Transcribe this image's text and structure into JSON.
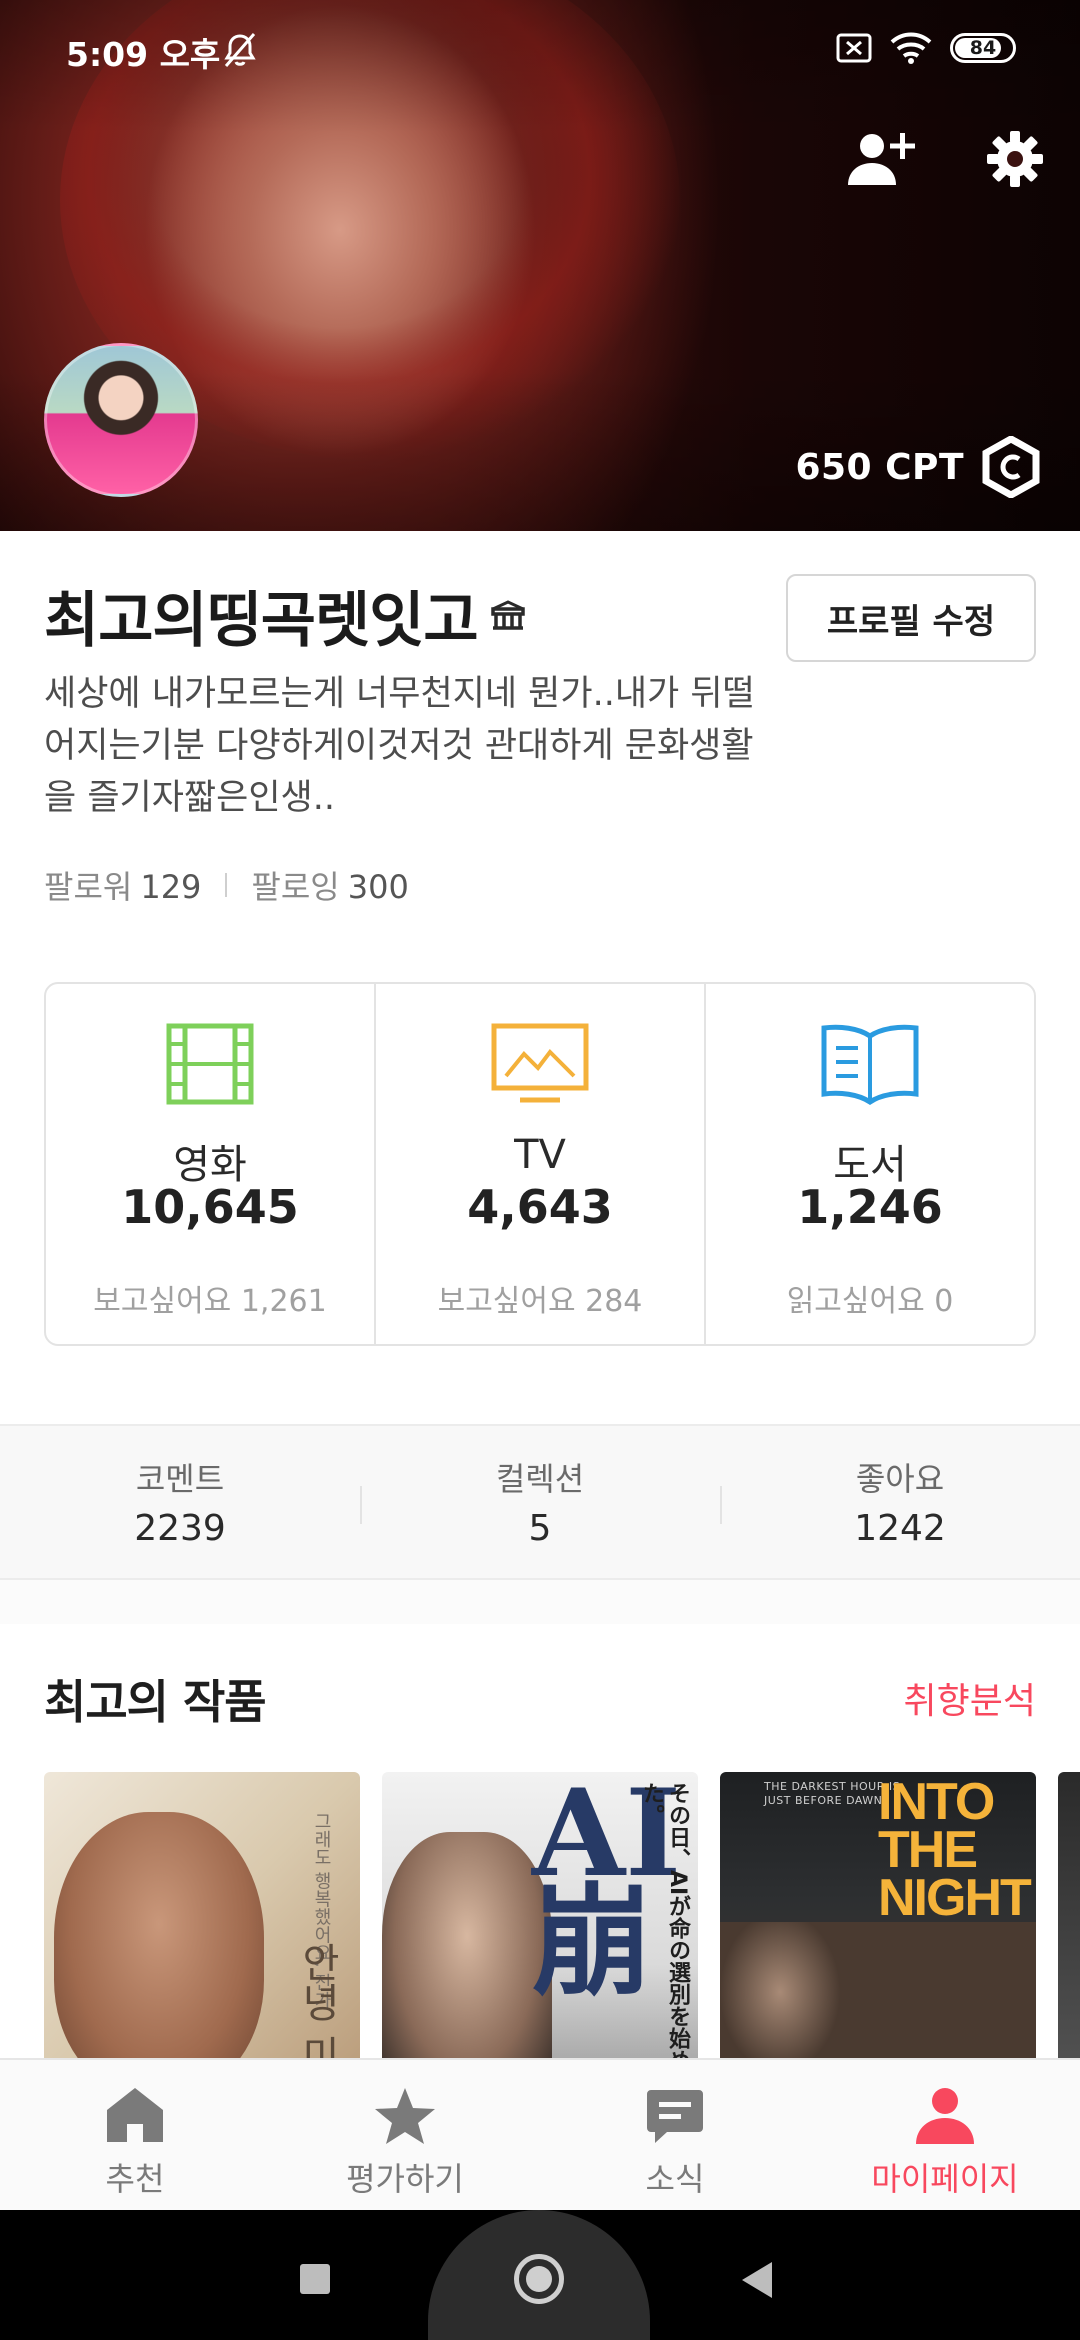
{
  "status_bar": {
    "time": "5:09 오후",
    "battery": "84",
    "battery_level_percent": 84
  },
  "header": {
    "cpt": "650 CPT",
    "icons": [
      "person-add-icon",
      "gear-icon",
      "cpt-hexagon-icon"
    ]
  },
  "profile": {
    "name": "최고의띵곡렛잇고",
    "edit_button": "프로필 수정",
    "bio": "세상에 내가모르는게 너무천지네 뭔가..내가 뒤떨어지는기분 다양하게이것저것 관대하게 문화생활을 즐기자짧은인생..",
    "followers_label": "팔로워",
    "followers": "129",
    "following_label": "팔로잉",
    "following": "300"
  },
  "stats": [
    {
      "label": "영화",
      "count": "10,645",
      "wish": "보고싶어요 1,261",
      "icon": "film-icon",
      "color": "#7ed05a"
    },
    {
      "label": "TV",
      "count": "4,643",
      "wish": "보고싶어요 284",
      "icon": "tv-icon",
      "color": "#f4b13a"
    },
    {
      "label": "도서",
      "count": "1,246",
      "wish": "읽고싶어요 0",
      "icon": "book-icon",
      "color": "#2a9be0"
    }
  ],
  "activity": [
    {
      "label": "코멘트",
      "value": "2239"
    },
    {
      "label": "컬렉션",
      "value": "5"
    },
    {
      "label": "좋아요",
      "value": "1242"
    }
  ],
  "best_works": {
    "title": "최고의 작품",
    "link": "취향분석",
    "posters": [
      {
        "top_text": "그래도 행복했어요, 전가",
        "title": "안녕 미"
      },
      {
        "big_text": "AI崩",
        "side_text": "その日、AIが命の選別を始めた。"
      },
      {
        "tag": "THE DARKEST HOUR IS JUST BEFORE DAWN",
        "title": "INTO THE NIGHT"
      },
      {}
    ]
  },
  "bottom_nav": [
    {
      "label": "추천",
      "icon": "home-icon",
      "active": false
    },
    {
      "label": "평가하기",
      "icon": "star-icon",
      "active": false
    },
    {
      "label": "소식",
      "icon": "chat-icon",
      "active": false
    },
    {
      "label": "마이페이지",
      "icon": "person-icon",
      "active": true
    }
  ],
  "colors": {
    "accent": "#f8485e",
    "inactive": "#7a7a7a"
  }
}
